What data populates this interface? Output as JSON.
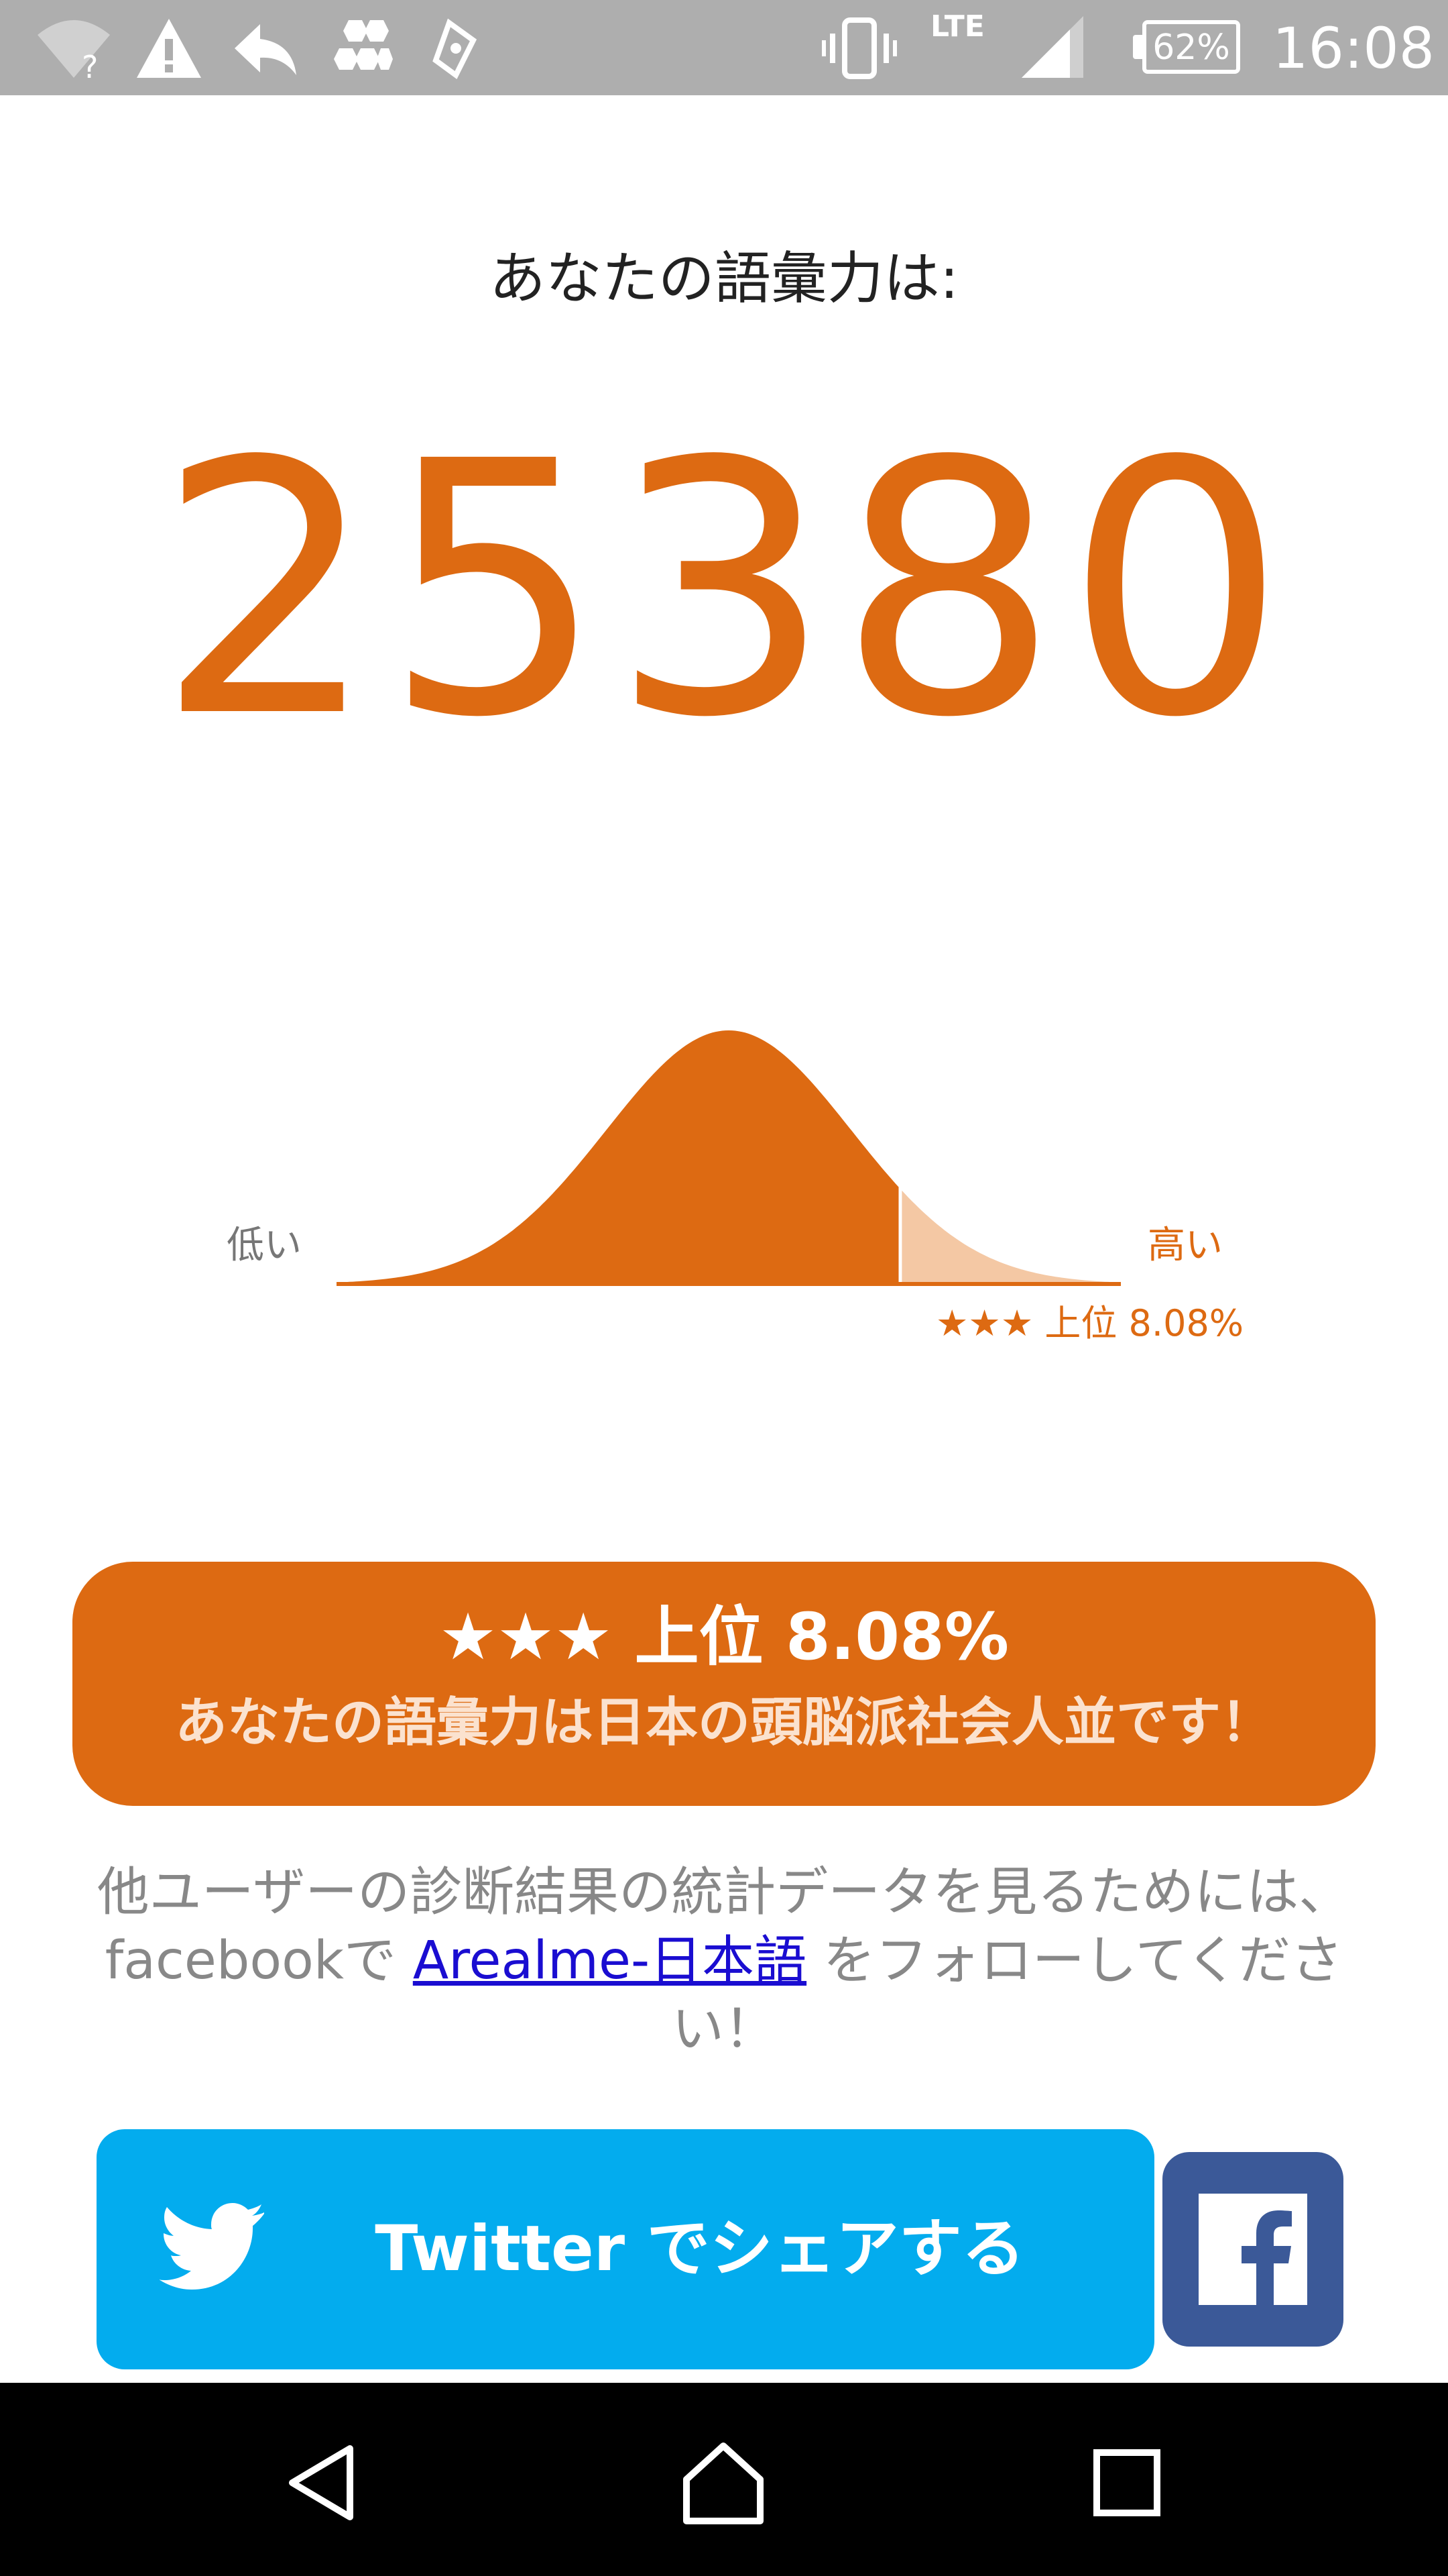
{
  "status_bar": {
    "network_type": "LTE",
    "battery_percent": "62%",
    "time": "16:08",
    "icons": [
      "wifi-unknown-icon",
      "warning-icon",
      "reply-icon",
      "hexagons-icon",
      "ticket-icon",
      "vibrate-icon",
      "signal-icon",
      "battery-icon"
    ]
  },
  "result": {
    "heading": "あなたの語彙力は:",
    "score": "25380"
  },
  "distribution": {
    "label_low": "低い",
    "label_high": "高い",
    "rank_small": "★★★ 上位 8.08%",
    "top_percent": 8.08
  },
  "result_card": {
    "rank": "★★★ 上位 8.08%",
    "message": "あなたの語彙力は日本の頭脳派社会人並です！"
  },
  "follow": {
    "text_before": "他ユーザーの診断結果の統計データを見るためには、facebookで ",
    "link_text": "Arealme-日本語",
    "text_after": " をフォローしてください！"
  },
  "share": {
    "twitter_label": "Twitter でシェアする"
  },
  "colors": {
    "accent": "#dd6a12",
    "twitter": "#03acee",
    "facebook": "#3b5998",
    "link": "#1a0dd1"
  },
  "nav_bar": {
    "icons": [
      "back-icon",
      "home-icon",
      "recents-icon"
    ]
  }
}
